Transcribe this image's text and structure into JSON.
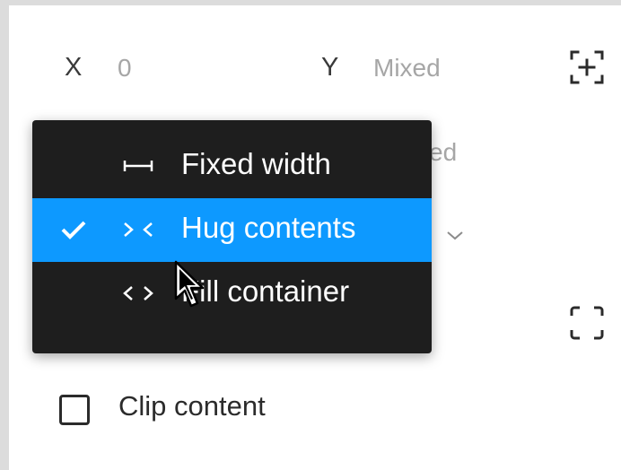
{
  "position": {
    "x_label": "X",
    "x_value": "0",
    "y_label": "Y",
    "y_value": "Mixed"
  },
  "hidden_row_partial_text": "ed",
  "icons": {
    "add_frame": "frame-add-icon",
    "fit_frame": "corner-brackets-icon",
    "dropdown_chevron": "chevron-down-icon"
  },
  "resizing_menu": {
    "items": [
      {
        "label": "Fixed width",
        "icon": "fixed-width-icon",
        "selected": false
      },
      {
        "label": "Hug contents",
        "icon": "hug-contents-icon",
        "selected": true
      },
      {
        "label": "Fill container",
        "icon": "fill-container-icon",
        "selected": false
      }
    ]
  },
  "clip_content": {
    "label": "Clip content",
    "checked": false
  },
  "colors": {
    "menu_background": "#1e1e1e",
    "selected_highlight": "#0d99ff",
    "label_text": "#3a3a3a",
    "value_text": "#a6a6a6"
  }
}
